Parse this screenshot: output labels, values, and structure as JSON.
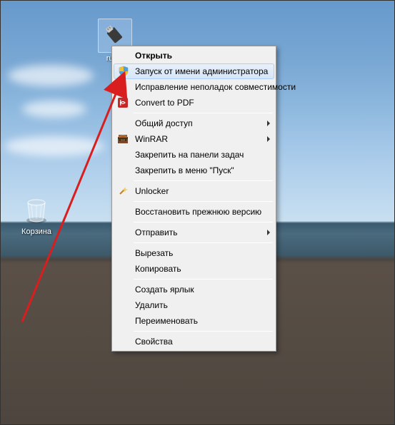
{
  "desktop_icons": {
    "rufus": {
      "label": "rufus"
    },
    "trash": {
      "label": "Корзина"
    }
  },
  "context_menu": {
    "items": {
      "open": {
        "label": "Открыть"
      },
      "run_admin": {
        "label": "Запуск от имени администратора"
      },
      "compat": {
        "label": "Исправление неполадок совместимости"
      },
      "pdf": {
        "label": "Convert to PDF"
      },
      "share": {
        "label": "Общий доступ"
      },
      "winrar": {
        "label": "WinRAR"
      },
      "pin_task": {
        "label": "Закрепить на панели задач"
      },
      "pin_start": {
        "label": "Закрепить в меню \"Пуск\""
      },
      "unlocker": {
        "label": "Unlocker"
      },
      "restore": {
        "label": "Восстановить прежнюю версию"
      },
      "send_to": {
        "label": "Отправить"
      },
      "cut": {
        "label": "Вырезать"
      },
      "copy": {
        "label": "Копировать"
      },
      "shortcut": {
        "label": "Создать ярлык"
      },
      "delete": {
        "label": "Удалить"
      },
      "rename": {
        "label": "Переименовать"
      },
      "properties": {
        "label": "Свойства"
      }
    }
  },
  "colors": {
    "annotation_arrow": "#d81e1e"
  }
}
